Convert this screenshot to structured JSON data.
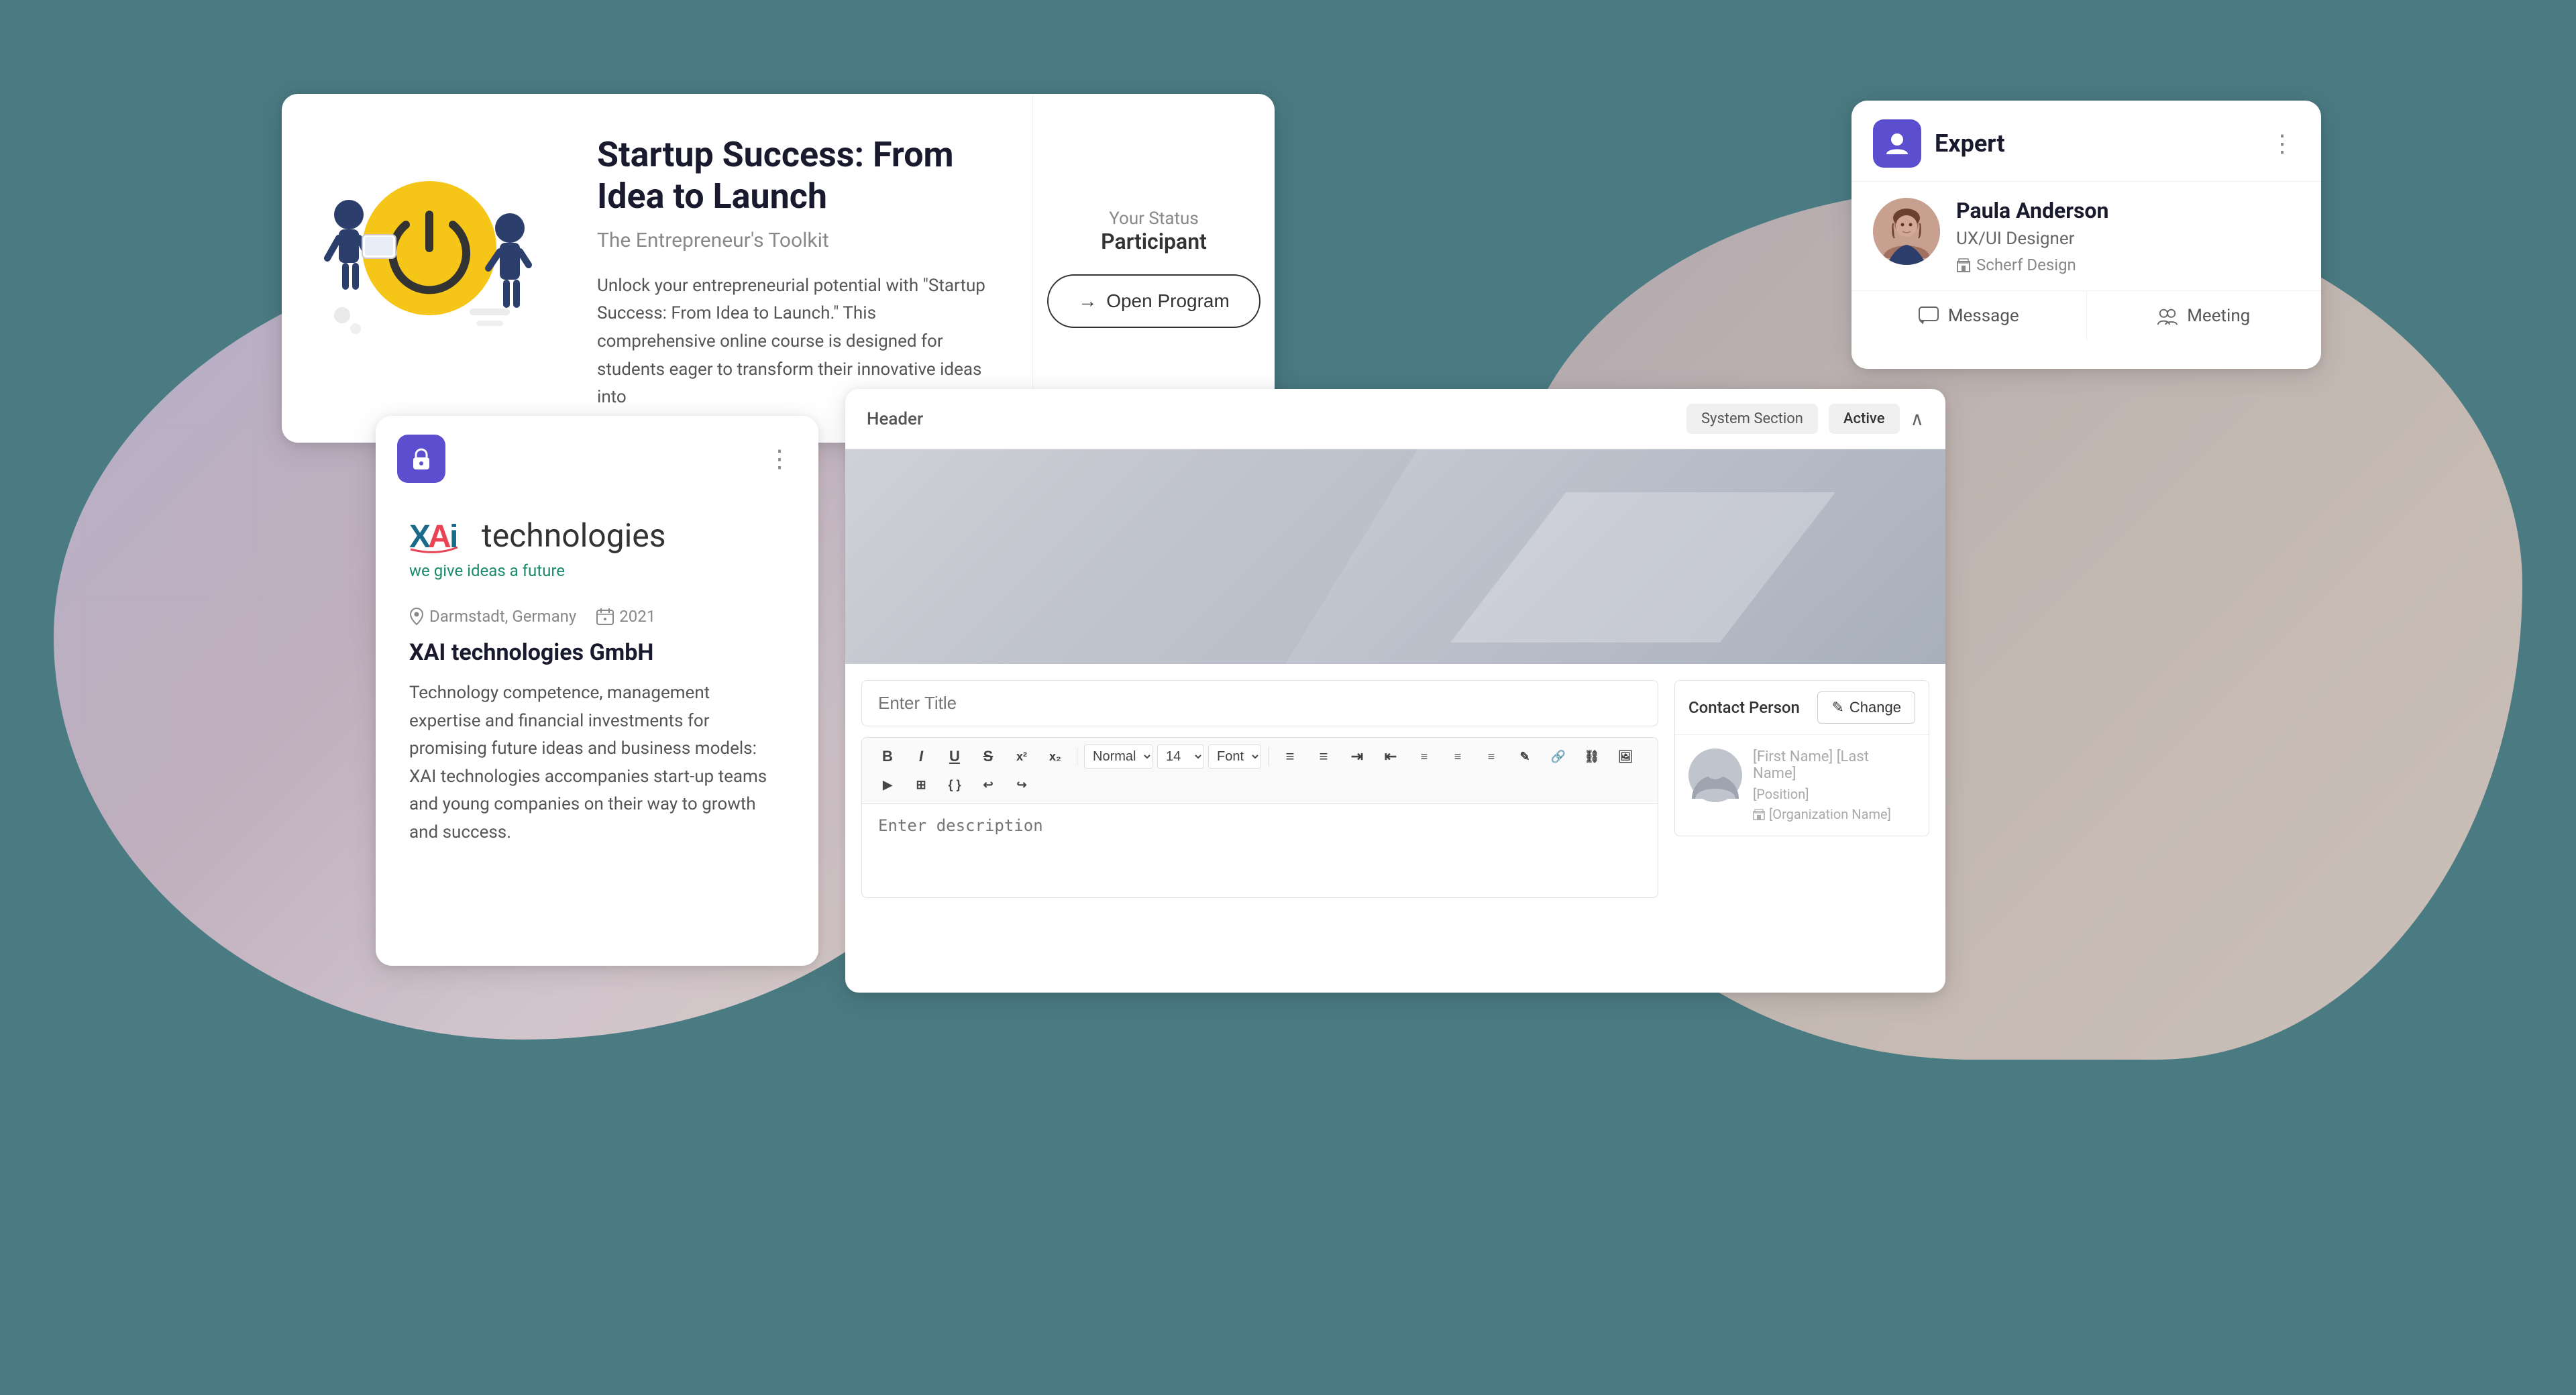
{
  "background": {
    "color": "#4a7a82"
  },
  "card_startup": {
    "title": "Startup Success: From Idea to Launch",
    "subtitle": "The Entrepreneur's Toolkit",
    "description": "Unlock your entrepreneurial potential with \"Startup Success: From Idea to Launch.\" This comprehensive online course is designed for students eager to transform their innovative ideas into",
    "status_label": "Your Status",
    "status_value": "Participant",
    "open_button": "Open Program"
  },
  "card_expert": {
    "header_icon": "person-icon",
    "title": "Expert",
    "more_icon": "more-dots-icon",
    "name": "Paula Anderson",
    "role": "UX/UI Designer",
    "company": "Scherf Design",
    "message_action": "Message",
    "meeting_action": "Meeting"
  },
  "card_xai": {
    "icon": "lock-icon",
    "logo_brand": "XAi",
    "logo_word": "technologies",
    "tagline": "we give ideas a future",
    "location": "Darmstadt, Germany",
    "year": "2021",
    "company_name": "XAI technologies GmbH",
    "description": "Technology competence, management expertise and financial investments for promising future ideas and business models: XAI technologies accompanies start-up teams and young companies on their way to growth and success.",
    "more_icon": "more-dots-icon"
  },
  "card_editor": {
    "header_label": "Header",
    "system_section_badge": "System Section",
    "active_badge": "Active",
    "chevron": "chevron-up",
    "title_placeholder": "Enter Title",
    "description_placeholder": "Enter description",
    "toolbar": {
      "bold": "B",
      "italic": "I",
      "underline": "U",
      "strikethrough": "S",
      "superscript": "x²",
      "subscript": "x₂",
      "format_select": "Normal",
      "size_select": "14",
      "font_select": "Font"
    },
    "contact_person_label": "Contact Person",
    "change_button": "Change",
    "contact_name_placeholder": "[First Name] [Last Name]",
    "contact_position_placeholder": "[Position]",
    "contact_org_placeholder": "[Organization Name]"
  }
}
